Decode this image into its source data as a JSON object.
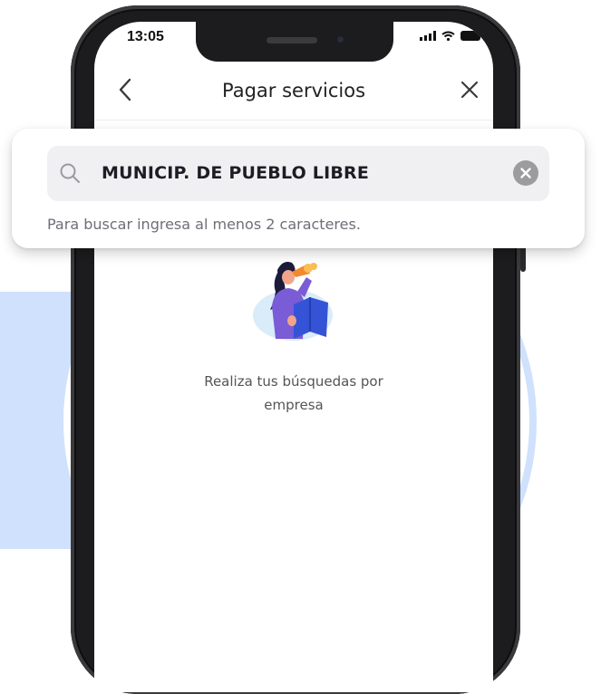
{
  "status_bar": {
    "time": "13:05"
  },
  "header": {
    "back_icon": "chevron-left-icon",
    "title": "Pagar servicios",
    "close_icon": "close-icon"
  },
  "search": {
    "icon": "search-icon",
    "value": "MUNICIP. DE PUEBLO LIBRE",
    "clear_icon": "clear-icon",
    "helper": "Para buscar ingresa al menos 2 caracteres."
  },
  "empty_state": {
    "illustration": "woman-binoculars-map-illustration",
    "line1": "Realiza tus búsquedas por",
    "line2": "empresa"
  },
  "colors": {
    "background_accent": "#cfe1fc",
    "phone_frame": "#1c1c1e",
    "illustration_purple": "#7a5cd6",
    "illustration_blue": "#3553d6"
  }
}
